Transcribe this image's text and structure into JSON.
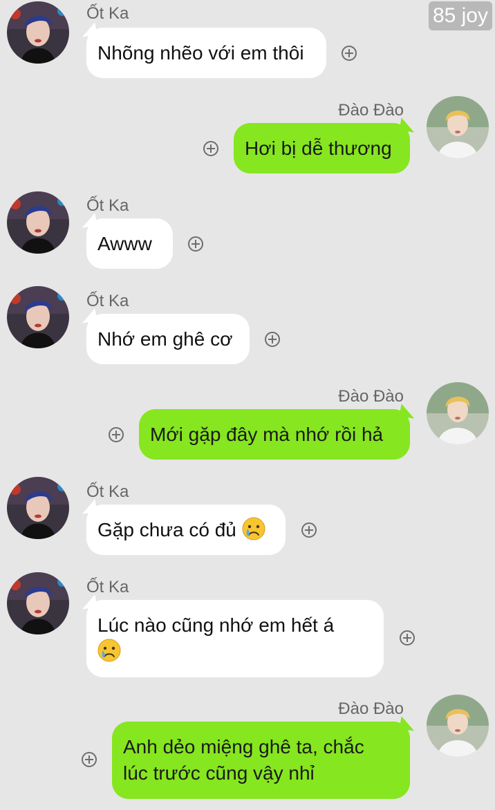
{
  "watermark": "85 joy",
  "messages": [
    {
      "sender": "Ốt Ka",
      "side": "left",
      "lines": [
        "Nhõng nhẽo với em thôi"
      ]
    },
    {
      "sender": "Đào Đào",
      "side": "right",
      "lines": [
        "Hơi bị dễ thương"
      ]
    },
    {
      "sender": "Ốt Ka",
      "side": "left",
      "lines": [
        "Awww"
      ]
    },
    {
      "sender": "Ốt Ka",
      "side": "left",
      "lines": [
        "Nhớ em ghê cơ"
      ]
    },
    {
      "sender": "Đào Đào",
      "side": "right",
      "lines": [
        "Mới gặp đây mà nhớ rồi hả"
      ]
    },
    {
      "sender": "Ốt Ka",
      "side": "left",
      "lines": [
        "Gặp chưa có đủ"
      ],
      "emoji": "crying-face-emoji"
    },
    {
      "sender": "Ốt Ka",
      "side": "left",
      "lines": [
        "Lúc nào cũng nhớ em hết á"
      ],
      "emoji_line2": "crying-face-emoji"
    },
    {
      "sender": "Đào Đào",
      "side": "right",
      "lines": [
        "Anh dẻo miệng ghê ta, chắc",
        "lúc trước cũng vậy nhỉ"
      ]
    }
  ],
  "colors": {
    "background": "#e6e6e6",
    "incoming_bubble": "#ffffff",
    "outgoing_bubble": "#86e61f",
    "name_text": "#666666"
  },
  "icons": {
    "reaction_button": "plus-circle-icon",
    "left_avatar": "avatar-ot-ka",
    "right_avatar": "avatar-dao-dao"
  }
}
